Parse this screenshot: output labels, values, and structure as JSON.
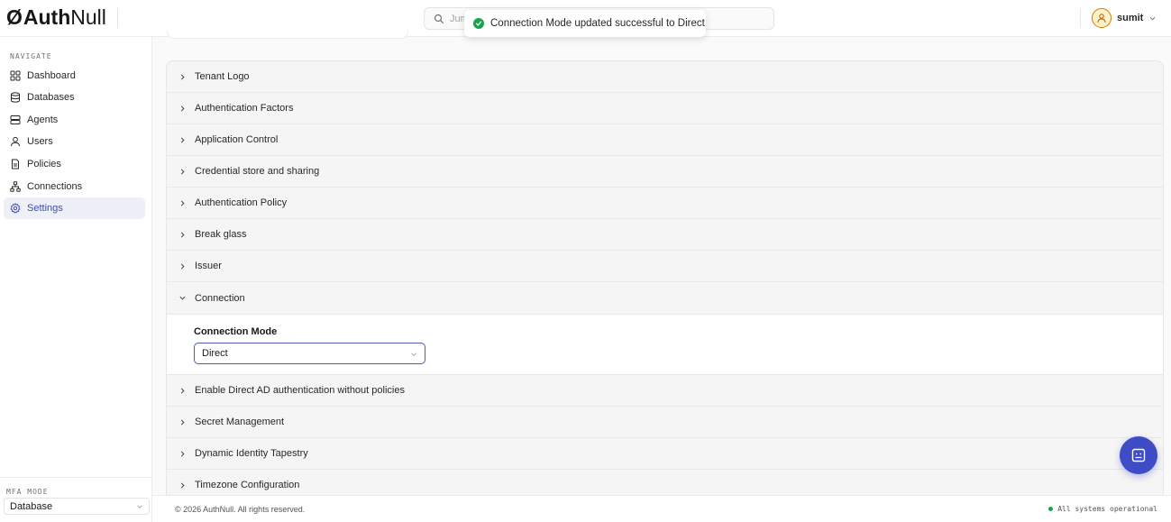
{
  "app": {
    "logo_symbol": "Ø",
    "logo_bold": "Auth",
    "logo_light": "Null"
  },
  "search": {
    "placeholder": "Jum"
  },
  "toast": {
    "message": "Connection Mode updated successful to Direct",
    "icon": "check-circle-icon",
    "color": "#16a34a"
  },
  "user": {
    "name": "sumit"
  },
  "sidebar": {
    "heading": "NAVIGATE",
    "items": [
      {
        "label": "Dashboard",
        "icon": "grid-icon"
      },
      {
        "label": "Databases",
        "icon": "database-icon"
      },
      {
        "label": "Agents",
        "icon": "server-icon"
      },
      {
        "label": "Users",
        "icon": "user-icon"
      },
      {
        "label": "Policies",
        "icon": "file-icon"
      },
      {
        "label": "Connections",
        "icon": "network-icon"
      },
      {
        "label": "Settings",
        "icon": "gear-icon",
        "active": true
      }
    ],
    "mfa_label": "MFA MODE",
    "mfa_value": "Database"
  },
  "settings": {
    "sections": [
      "Tenant Logo",
      "Authentication Factors",
      "Application Control",
      "Credential store and sharing",
      "Authentication Policy",
      "Break glass",
      "Issuer",
      "Connection",
      "Enable Direct AD authentication without policies",
      "Secret Management",
      "Dynamic Identity Tapestry",
      "Timezone Configuration"
    ],
    "expanded": "Connection",
    "connection": {
      "field_label": "Connection Mode",
      "value": "Direct"
    }
  },
  "footer": {
    "copyright": "© 2026 AuthNull. All rights reserved.",
    "status": "All systems operational"
  },
  "colors": {
    "accent": "#3f4cc8",
    "active_bg": "#eef0f8",
    "success": "#16a34a"
  }
}
